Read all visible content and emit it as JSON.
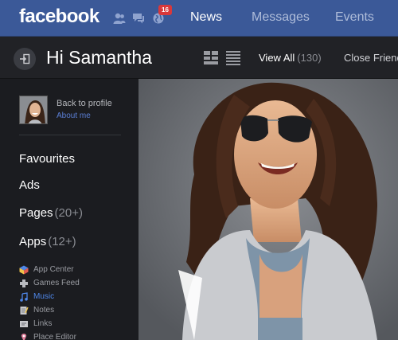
{
  "topbar": {
    "logo": "facebook",
    "notification_count": "16",
    "nav": [
      {
        "label": "News",
        "active": true
      },
      {
        "label": "Messages",
        "active": false
      },
      {
        "label": "Events",
        "active": false
      }
    ]
  },
  "subbar": {
    "greeting": "Hi Samantha",
    "view_all_label": "View All",
    "view_all_count": "(130)",
    "close_friends_label": "Close Friend"
  },
  "sidebar": {
    "back_to_profile": "Back to profile",
    "about_me": "About me",
    "menu": [
      {
        "label": "Favourites",
        "count": ""
      },
      {
        "label": "Ads",
        "count": ""
      },
      {
        "label": "Pages",
        "count": "(20+)"
      },
      {
        "label": "Apps",
        "count": "(12+)"
      }
    ],
    "apps": [
      {
        "label": "App Center",
        "icon": "app-center-icon",
        "selected": false
      },
      {
        "label": "Games Feed",
        "icon": "games-feed-icon",
        "selected": false
      },
      {
        "label": "Music",
        "icon": "music-note-icon",
        "selected": true
      },
      {
        "label": "Notes",
        "icon": "notes-icon",
        "selected": false
      },
      {
        "label": "Links",
        "icon": "links-icon",
        "selected": false
      },
      {
        "label": "Place Editor",
        "icon": "place-editor-icon",
        "selected": false
      }
    ]
  },
  "colors": {
    "brand_blue": "#3b5998",
    "sidebar_bg": "#1b1c20",
    "link_blue": "#4e86e8",
    "badge_red": "#d9383b"
  }
}
